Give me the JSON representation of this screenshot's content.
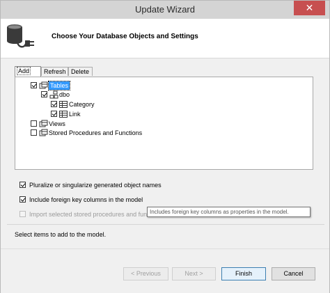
{
  "window": {
    "title": "Update Wizard",
    "close_glyph": "✕"
  },
  "header": {
    "heading": "Choose Your Database Objects and Settings",
    "icon": "database-connection-icon"
  },
  "tabs": [
    {
      "label": "Add",
      "active": true
    },
    {
      "label": "Refresh",
      "active": false
    },
    {
      "label": "Delete",
      "active": false
    }
  ],
  "tree": {
    "tables": {
      "label": "Tables",
      "checked": true,
      "selected": true
    },
    "dbo": {
      "label": "dbo",
      "checked": true
    },
    "category": {
      "label": "Category",
      "checked": true
    },
    "link": {
      "label": "Link",
      "checked": true
    },
    "views": {
      "label": "Views",
      "checked": false
    },
    "stored_procs": {
      "label": "Stored Procedures and Functions",
      "checked": false
    }
  },
  "options": {
    "pluralize": {
      "label": "Pluralize or singularize generated object names",
      "checked": true
    },
    "foreign_keys": {
      "label": "Include foreign key columns in the model",
      "checked": true
    },
    "import_procs": {
      "label": "Import selected stored procedures and fun",
      "checked": false,
      "disabled": true
    }
  },
  "tooltip": "Includes foreign key columns as properties in the model.",
  "status": "Select items to add to the model.",
  "buttons": {
    "previous": "< Previous",
    "next": "Next >",
    "finish": "Finish",
    "cancel": "Cancel"
  },
  "colors": {
    "selection": "#3399ff",
    "close_button": "#c74f50",
    "default_button_border": "#3c7fb1"
  }
}
